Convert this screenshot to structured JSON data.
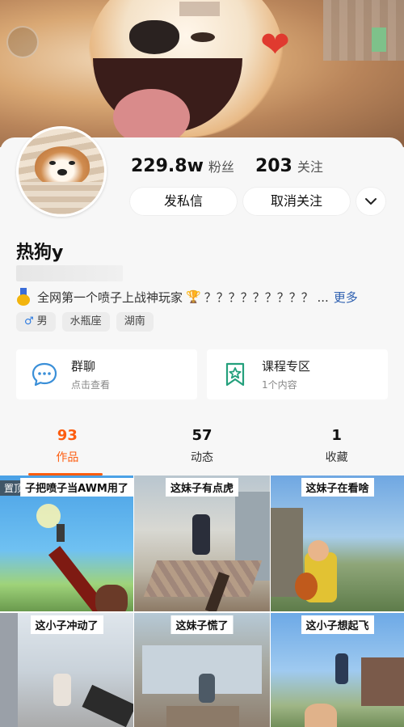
{
  "profile": {
    "followers": "229.8w",
    "followers_label": "粉丝",
    "following": "203",
    "following_label": "关注",
    "btn_message": "发私信",
    "btn_unfollow": "取消关注",
    "nickname": "热狗y",
    "bio_text": "全网第一个喷子上战神玩家",
    "bio_tail": "？？？？？？？？？ ...",
    "bio_more": "更多",
    "tags": [
      "男",
      "水瓶座",
      "湖南"
    ]
  },
  "cards": [
    {
      "title": "群聊",
      "sub": "点击查看",
      "icon": "chat-bubble-icon"
    },
    {
      "title": "课程专区",
      "sub": "1个内容",
      "icon": "bookmark-star-icon"
    }
  ],
  "tabs": [
    {
      "count": "93",
      "label": "作品"
    },
    {
      "count": "57",
      "label": "动态"
    },
    {
      "count": "1",
      "label": "收藏"
    }
  ],
  "videos": [
    {
      "caption": "子把喷子当AWM用了",
      "pinned": "置顶"
    },
    {
      "caption": "这妹子有点虎"
    },
    {
      "caption": "这妹子在看啥"
    },
    {
      "caption": "这小子冲动了"
    },
    {
      "caption": "这妹子慌了"
    },
    {
      "caption": "这小子想起飞"
    }
  ],
  "colors": {
    "accent": "#fd5d10",
    "link": "#2d5fb0",
    "male": "#2a79e0"
  }
}
